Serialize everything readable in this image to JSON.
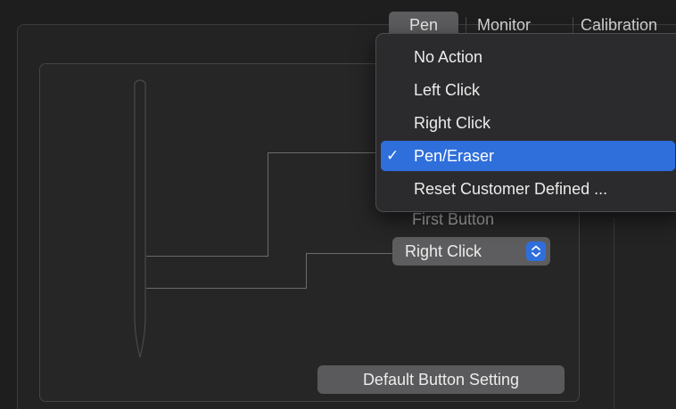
{
  "tabs": [
    {
      "label": "Pen",
      "selected": true
    },
    {
      "label": "Monitor",
      "selected": false
    },
    {
      "label": "Calibration",
      "selected": false
    }
  ],
  "pen_panel": {
    "first_button_label": "First Button",
    "first_button_value": "Right Click",
    "default_button_label": "Default  Button Setting"
  },
  "menu": {
    "items": [
      {
        "label": "No Action",
        "selected": false
      },
      {
        "label": "Left Click",
        "selected": false
      },
      {
        "label": "Right Click",
        "selected": false
      },
      {
        "label": "Pen/Eraser",
        "selected": true
      },
      {
        "label": "Reset Customer Defined ...",
        "selected": false
      }
    ],
    "check_glyph": "✓"
  },
  "icons": {
    "popup_chevron": "chevron-up-down-icon",
    "check": "checkmark-icon"
  },
  "colors": {
    "accent": "#2f6fdc",
    "background": "#1e1e1e",
    "menu_background": "#2b2b2d"
  }
}
